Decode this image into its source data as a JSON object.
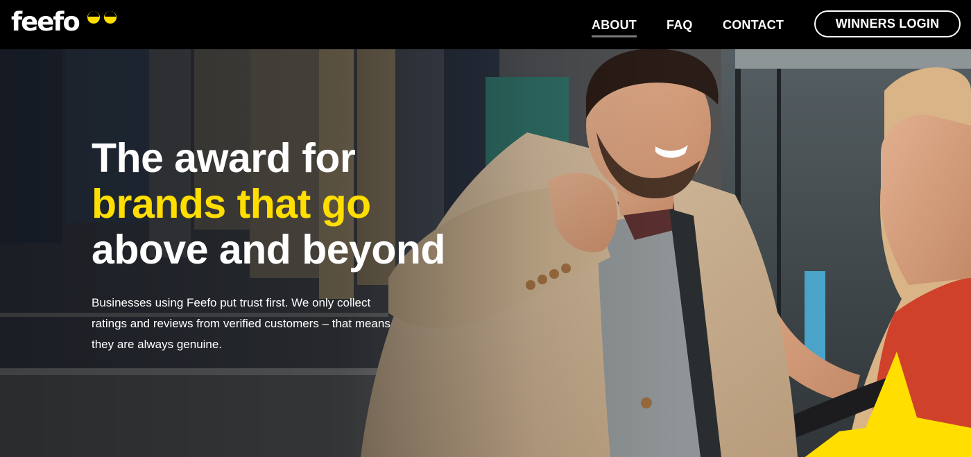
{
  "brand": {
    "logo_text": "feefo",
    "logo_icon": "eyes-icon",
    "accent_color": "#ffde00"
  },
  "nav": {
    "items": [
      {
        "label": "ABOUT",
        "active": true
      },
      {
        "label": "FAQ",
        "active": false
      },
      {
        "label": "CONTACT",
        "active": false
      }
    ],
    "login_label": "WINNERS LOGIN"
  },
  "hero": {
    "headline_line1": "The award for",
    "headline_line2": "brands that go",
    "headline_line3": "above and beyond",
    "body": "Businesses using Feefo put trust first. We only collect ratings and reviews from verified customers – that means they are always genuine.",
    "photo": "smiling man trying on a beige blazer with a woman in a clothing store",
    "decoration": "yellow-star-icon"
  }
}
